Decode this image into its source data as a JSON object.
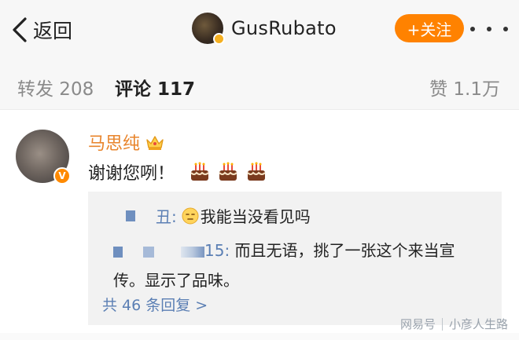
{
  "nav": {
    "back_label": "返回",
    "nickname": "GusRubato",
    "follow_label": "+关注"
  },
  "tabs": {
    "repost": "转发 208",
    "comment": "评论 117",
    "like": "赞 1.1万"
  },
  "comment": {
    "user": "马思纯",
    "text": "谢谢您咧！",
    "cake_count": 3,
    "replies": [
      {
        "user_suffix": "丑:",
        "text": "我能当没看见吗"
      },
      {
        "user_suffix": "15:",
        "text": "而且无语，挑了一张这个来当宣传。显示了品味。"
      }
    ],
    "more_replies": "共 46 条回复 >"
  },
  "watermark": {
    "left": "网易号",
    "right": "小彦人生路"
  },
  "colors": {
    "accent_orange": "#ff8200",
    "username_orange": "#e8842b",
    "link_blue": "#5b7fb4",
    "background": "#f7f7f7"
  }
}
